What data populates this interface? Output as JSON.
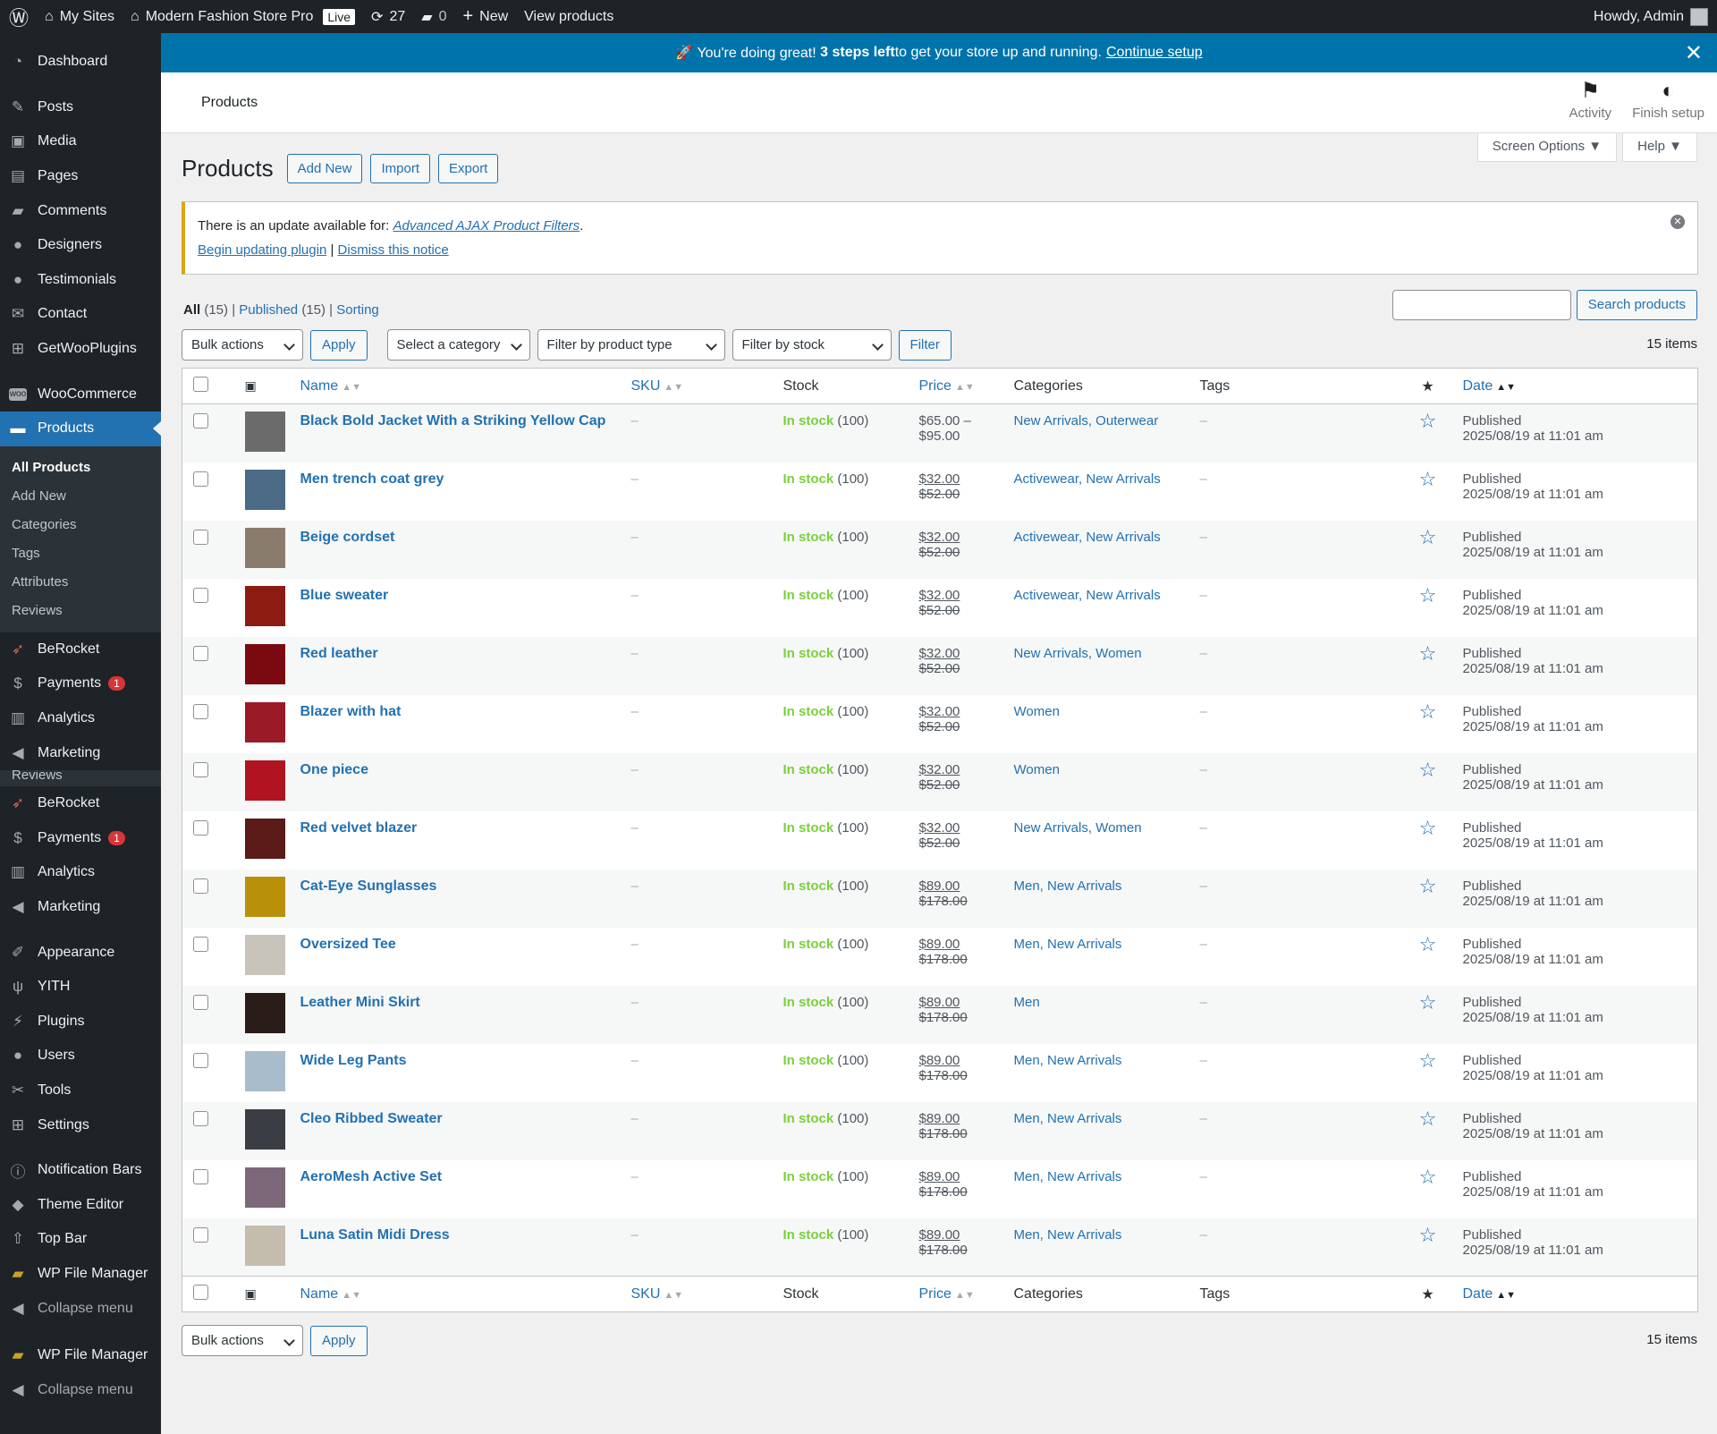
{
  "adminbar": {
    "my_sites": "My Sites",
    "site_name": "Modern Fashion Store Pro",
    "live_badge": "Live",
    "updates_count": "27",
    "comments_count": "0",
    "new_label": "New",
    "view_products": "View products",
    "howdy": "Howdy, Admin"
  },
  "sidebar": {
    "items_top": [
      "Dashboard"
    ],
    "items_content": [
      "Posts",
      "Media",
      "Pages",
      "Comments",
      "Designers",
      "Testimonials",
      "Contact",
      "GetWooPlugins"
    ],
    "woocommerce": "WooCommerce",
    "products": "Products",
    "submenu": [
      "All Products",
      "Add New",
      "Categories",
      "Tags",
      "Attributes",
      "Reviews"
    ],
    "after1": [
      "BeRocket",
      "Payments",
      "Analytics",
      "Marketing"
    ],
    "ghost_reviews": "Reviews",
    "after2": [
      "BeRocket",
      "Payments",
      "Analytics",
      "Marketing"
    ],
    "payments_badge": "1",
    "appearance_group": [
      "Appearance",
      "YITH",
      "Plugins",
      "Users",
      "Tools",
      "Settings"
    ],
    "plugins_group": [
      "Notification Bars",
      "Theme Editor",
      "Top Bar",
      "WP File Manager"
    ],
    "collapse": "Collapse menu",
    "wp_file_manager_2": "WP File Manager",
    "collapse_2": "Collapse menu"
  },
  "setup_notice": {
    "prefix": "🚀 You're doing great! ",
    "bold": "3 steps left",
    "suffix": " to get your store up and running.",
    "link": "Continue setup"
  },
  "wc_header": {
    "title": "Products",
    "activity": "Activity",
    "finish_setup": "Finish setup"
  },
  "screen_tabs": {
    "screen_options": "Screen Options",
    "help": "Help"
  },
  "page": {
    "title": "Products",
    "add_new": "Add New",
    "import": "Import",
    "export": "Export"
  },
  "update_notice": {
    "text": "There is an update available for: ",
    "plugin": "Advanced AJAX Product Filters",
    "period": ".",
    "begin": "Begin updating plugin",
    "sep": " | ",
    "dismiss": "Dismiss this notice"
  },
  "views": {
    "all": "All",
    "all_count": "(15)",
    "published": "Published",
    "published_count": "(15)",
    "sorting": "Sorting"
  },
  "search": {
    "button": "Search products",
    "placeholder": ""
  },
  "tablenav": {
    "bulk_actions": "Bulk actions",
    "apply": "Apply",
    "category": "Select a category",
    "product_type": "Filter by product type",
    "stock_status": "Filter by stock status",
    "filter": "Filter",
    "items": "15 items"
  },
  "columns": {
    "name": "Name",
    "sku": "SKU",
    "stock": "Stock",
    "price": "Price",
    "categories": "Categories",
    "tags": "Tags",
    "date": "Date"
  },
  "products": [
    {
      "name": "Black Bold Jacket With a Striking Yellow Cap",
      "sku": "–",
      "stock": "In stock",
      "qty": "(100)",
      "price_top": "$65.00 –",
      "price_bottom": "$95.00",
      "range": true,
      "categories": "New Arrivals, Outerwear",
      "tags": "–",
      "status": "Published",
      "date": "2025/08/19 at 11:01 am",
      "thumb_color": "#6b6b6b"
    },
    {
      "name": "Men trench coat grey",
      "sku": "–",
      "stock": "In stock",
      "qty": "(100)",
      "price_top": "$32.00",
      "price_bottom": "$52.00",
      "range": false,
      "categories": "Activewear, New Arrivals",
      "tags": "–",
      "status": "Published",
      "date": "2025/08/19 at 11:01 am",
      "thumb_color": "#4a6a85"
    },
    {
      "name": "Beige cordset",
      "sku": "–",
      "stock": "In stock",
      "qty": "(100)",
      "price_top": "$32.00",
      "price_bottom": "$52.00",
      "range": false,
      "categories": "Activewear, New Arrivals",
      "tags": "–",
      "status": "Published",
      "date": "2025/08/19 at 11:01 am",
      "thumb_color": "#8a7c6c"
    },
    {
      "name": "Blue sweater",
      "sku": "–",
      "stock": "In stock",
      "qty": "(100)",
      "price_top": "$32.00",
      "price_bottom": "$52.00",
      "range": false,
      "categories": "Activewear, New Arrivals",
      "tags": "–",
      "status": "Published",
      "date": "2025/08/19 at 11:01 am",
      "thumb_color": "#8c1b12"
    },
    {
      "name": "Red leather",
      "sku": "–",
      "stock": "In stock",
      "qty": "(100)",
      "price_top": "$32.00",
      "price_bottom": "$52.00",
      "range": false,
      "categories": "New Arrivals, Women",
      "tags": "–",
      "status": "Published",
      "date": "2025/08/19 at 11:01 am",
      "thumb_color": "#7a0a10"
    },
    {
      "name": "Blazer with hat",
      "sku": "–",
      "stock": "In stock",
      "qty": "(100)",
      "price_top": "$32.00",
      "price_bottom": "$52.00",
      "range": false,
      "categories": "Women",
      "tags": "–",
      "status": "Published",
      "date": "2025/08/19 at 11:01 am",
      "thumb_color": "#9a1a28"
    },
    {
      "name": "One piece",
      "sku": "–",
      "stock": "In stock",
      "qty": "(100)",
      "price_top": "$32.00",
      "price_bottom": "$52.00",
      "range": false,
      "categories": "Women",
      "tags": "–",
      "status": "Published",
      "date": "2025/08/19 at 11:01 am",
      "thumb_color": "#b01420"
    },
    {
      "name": "Red velvet blazer",
      "sku": "–",
      "stock": "In stock",
      "qty": "(100)",
      "price_top": "$32.00",
      "price_bottom": "$52.00",
      "range": false,
      "categories": "New Arrivals, Women",
      "tags": "–",
      "status": "Published",
      "date": "2025/08/19 at 11:01 am",
      "thumb_color": "#5a1a18"
    },
    {
      "name": "Cat-Eye Sunglasses",
      "sku": "–",
      "stock": "In stock",
      "qty": "(100)",
      "price_top": "$89.00",
      "price_bottom": "$178.00",
      "range": false,
      "categories": "Men, New Arrivals",
      "tags": "–",
      "status": "Published",
      "date": "2025/08/19 at 11:01 am",
      "thumb_color": "#b8900a"
    },
    {
      "name": "Oversized Tee",
      "sku": "–",
      "stock": "In stock",
      "qty": "(100)",
      "price_top": "$89.00",
      "price_bottom": "$178.00",
      "range": false,
      "categories": "Men, New Arrivals",
      "tags": "–",
      "status": "Published",
      "date": "2025/08/19 at 11:01 am",
      "thumb_color": "#c8c4bc"
    },
    {
      "name": "Leather Mini Skirt",
      "sku": "–",
      "stock": "In stock",
      "qty": "(100)",
      "price_top": "$89.00",
      "price_bottom": "$178.00",
      "range": false,
      "categories": "Men",
      "tags": "–",
      "status": "Published",
      "date": "2025/08/19 at 11:01 am",
      "thumb_color": "#2a1c18"
    },
    {
      "name": "Wide Leg Pants",
      "sku": "–",
      "stock": "In stock",
      "qty": "(100)",
      "price_top": "$89.00",
      "price_bottom": "$178.00",
      "range": false,
      "categories": "Men, New Arrivals",
      "tags": "–",
      "status": "Published",
      "date": "2025/08/19 at 11:01 am",
      "thumb_color": "#a8bccc"
    },
    {
      "name": "Cleo Ribbed Sweater",
      "sku": "–",
      "stock": "In stock",
      "qty": "(100)",
      "price_top": "$89.00",
      "price_bottom": "$178.00",
      "range": false,
      "categories": "Men, New Arrivals",
      "tags": "–",
      "status": "Published",
      "date": "2025/08/19 at 11:01 am",
      "thumb_color": "#3a3e44"
    },
    {
      "name": "AeroMesh Active Set",
      "sku": "–",
      "stock": "In stock",
      "qty": "(100)",
      "price_top": "$89.00",
      "price_bottom": "$178.00",
      "range": false,
      "categories": "Men, New Arrivals",
      "tags": "–",
      "status": "Published",
      "date": "2025/08/19 at 11:01 am",
      "thumb_color": "#7c6878"
    },
    {
      "name": "Luna Satin Midi Dress",
      "sku": "–",
      "stock": "In stock",
      "qty": "(100)",
      "price_top": "$89.00",
      "price_bottom": "$178.00",
      "range": false,
      "categories": "Men, New Arrivals",
      "tags": "–",
      "status": "Published",
      "date": "2025/08/19 at 11:01 am",
      "thumb_color": "#c4bcac"
    }
  ],
  "colors": {
    "adminbar": "#1d2327",
    "accent": "#2271b1",
    "notice_blue": "#0073aa",
    "in_stock": "#7ad03a",
    "warning": "#dba617"
  }
}
